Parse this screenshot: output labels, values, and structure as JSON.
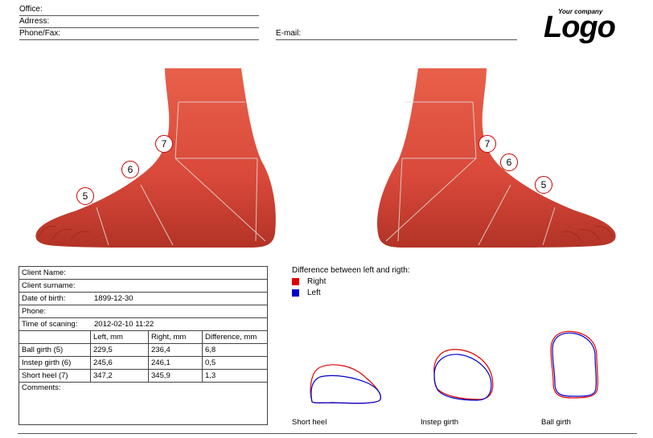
{
  "header": {
    "office_label": "Office:",
    "address_label": "Adrress:",
    "phone_label": "Phone/Fax:",
    "email_label": "E-mail:"
  },
  "logo": {
    "small_text": "Your company",
    "big_text": "Logo"
  },
  "markers": {
    "left_foot": [
      "7",
      "6",
      "5"
    ],
    "right_foot": [
      "7",
      "6",
      "5"
    ]
  },
  "client": {
    "name_label": "Client Name:",
    "surname_label": "Client surname:",
    "dob_label": "Date of birth:",
    "dob_value": "1899-12-30",
    "phone_label": "Phone:",
    "time_label": "Time of scaning:",
    "time_value": "2012-02-10 11:22",
    "columns": [
      "",
      "Left, mm",
      "Right, mm",
      "Difference, mm"
    ],
    "rows": [
      {
        "label": "Ball girth (5)",
        "left": "229,5",
        "right": "236,4",
        "diff": "6,8"
      },
      {
        "label": "Instep girth (6)",
        "left": "245,6",
        "right": "246,1",
        "diff": "0,5"
      },
      {
        "label": "Short heel (7)",
        "left": "347,2",
        "right": "345,9",
        "diff": "1,3"
      }
    ],
    "comments_label": "Comments:"
  },
  "legend": {
    "title": "Difference between left and rigth:",
    "right_label": "Right",
    "left_label": "Left",
    "right_color": "#e00000",
    "left_color": "#0000cc"
  },
  "captions": {
    "short_heel": "Short heel",
    "instep_girth": "Instep girth",
    "ball_girth": "Ball girth"
  }
}
